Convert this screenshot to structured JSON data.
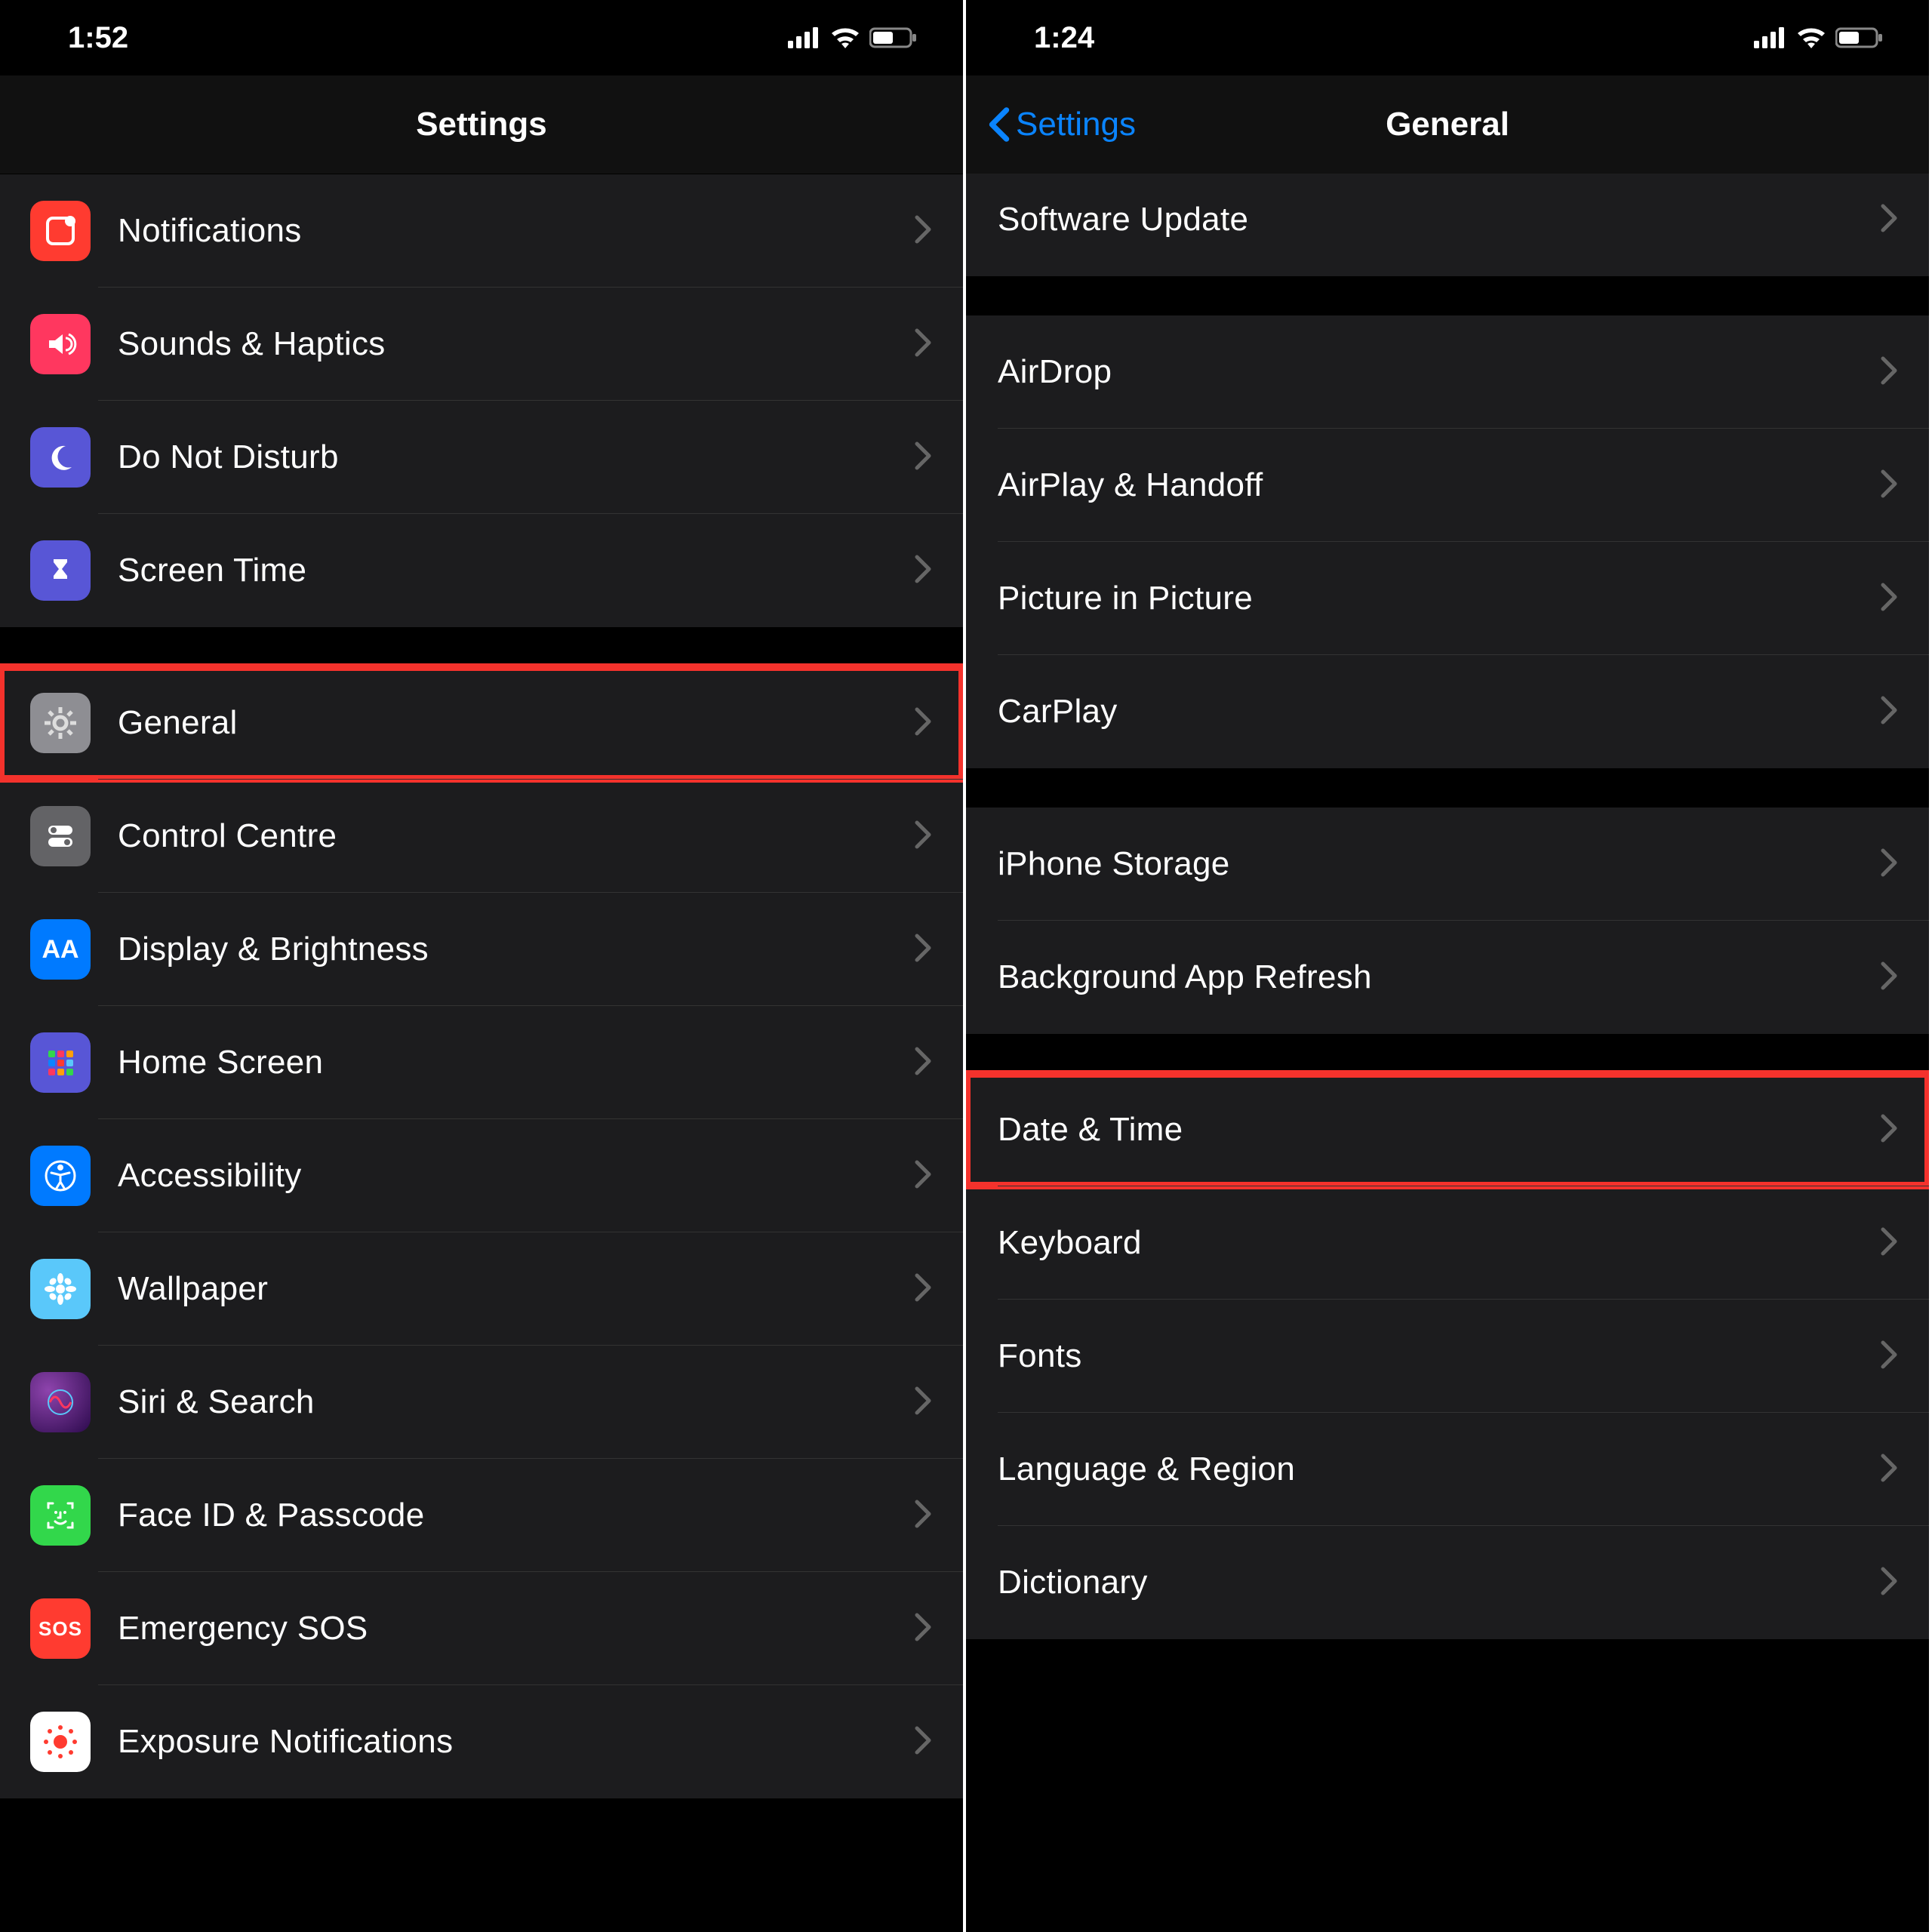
{
  "left": {
    "status": {
      "time": "1:52"
    },
    "nav": {
      "title": "Settings"
    },
    "groups": [
      {
        "rows": [
          {
            "name": "notifications",
            "label": "Notifications",
            "icon": "notifications-icon",
            "bg": "bg-red"
          },
          {
            "name": "sounds",
            "label": "Sounds & Haptics",
            "icon": "speaker-icon",
            "bg": "bg-pink"
          },
          {
            "name": "dnd",
            "label": "Do Not Disturb",
            "icon": "moon-icon",
            "bg": "bg-indigo"
          },
          {
            "name": "screentime",
            "label": "Screen Time",
            "icon": "hourglass-icon",
            "bg": "bg-indigo"
          }
        ]
      },
      {
        "rows": [
          {
            "name": "general",
            "label": "General",
            "icon": "gear-icon",
            "bg": "bg-gray",
            "highlight": true
          },
          {
            "name": "controlcentre",
            "label": "Control Centre",
            "icon": "toggles-icon",
            "bg": "bg-darkgray"
          },
          {
            "name": "display",
            "label": "Display & Brightness",
            "icon": "textsize-icon",
            "bg": "bg-blue"
          },
          {
            "name": "homescreen",
            "label": "Home Screen",
            "icon": "grid-icon",
            "bg": "bg-blue"
          },
          {
            "name": "accessibility",
            "label": "Accessibility",
            "icon": "accessibility-icon",
            "bg": "bg-blue"
          },
          {
            "name": "wallpaper",
            "label": "Wallpaper",
            "icon": "flower-icon",
            "bg": "bg-cyan"
          },
          {
            "name": "siri",
            "label": "Siri & Search",
            "icon": "siri-icon",
            "bg": "bg-multi"
          },
          {
            "name": "faceid",
            "label": "Face ID & Passcode",
            "icon": "face-icon",
            "bg": "bg-green"
          },
          {
            "name": "sos",
            "label": "Emergency SOS",
            "icon": "sos-icon",
            "bg": "bg-sos"
          },
          {
            "name": "exposure",
            "label": "Exposure Notifications",
            "icon": "exposure-icon",
            "bg": "bg-expo"
          }
        ]
      }
    ]
  },
  "right": {
    "status": {
      "time": "1:24"
    },
    "nav": {
      "back": "Settings",
      "title": "General"
    },
    "groups": [
      {
        "rows": [
          {
            "name": "swupdate",
            "label": "Software Update"
          }
        ]
      },
      {
        "rows": [
          {
            "name": "airdrop",
            "label": "AirDrop"
          },
          {
            "name": "airplay",
            "label": "AirPlay & Handoff"
          },
          {
            "name": "pip",
            "label": "Picture in Picture"
          },
          {
            "name": "carplay",
            "label": "CarPlay"
          }
        ]
      },
      {
        "rows": [
          {
            "name": "storage",
            "label": "iPhone Storage"
          },
          {
            "name": "bgrefresh",
            "label": "Background App Refresh"
          }
        ]
      },
      {
        "rows": [
          {
            "name": "datetime",
            "label": "Date & Time",
            "highlight": true
          },
          {
            "name": "keyboard",
            "label": "Keyboard"
          },
          {
            "name": "fonts",
            "label": "Fonts"
          },
          {
            "name": "language",
            "label": "Language & Region"
          },
          {
            "name": "dictionary",
            "label": "Dictionary"
          }
        ]
      }
    ]
  }
}
